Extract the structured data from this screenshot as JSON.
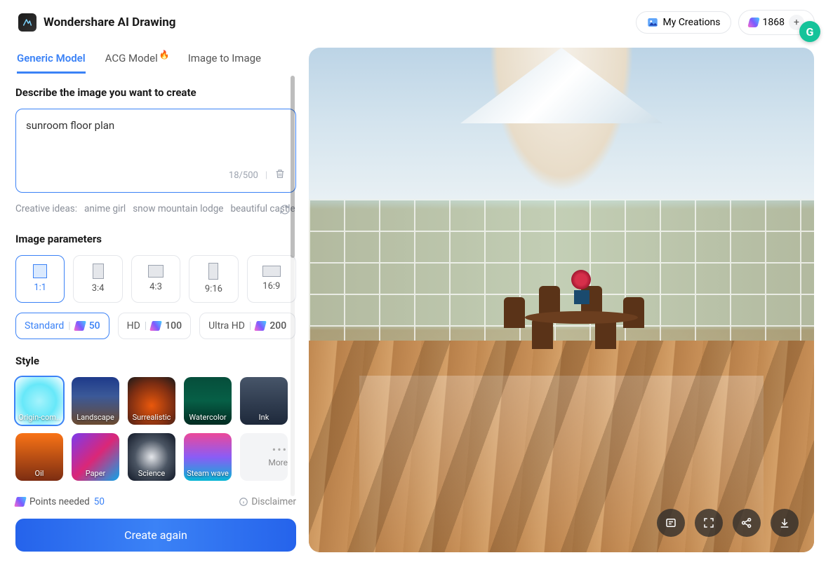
{
  "header": {
    "brand": "Wondershare AI Drawing",
    "my_creations": "My Creations",
    "credits": "1868"
  },
  "tabs": {
    "generic": "Generic Model",
    "acg": "ACG Model",
    "img2img": "Image to Image"
  },
  "prompt": {
    "heading": "Describe the image you want to create",
    "text": "sunroom floor plan",
    "counter": "18/500",
    "ideas_label": "Creative ideas:",
    "idea1": "anime girl",
    "idea2": "snow mountain lodge",
    "idea3": "beautiful castle"
  },
  "params": {
    "heading": "Image parameters",
    "ratios": {
      "r1": "1:1",
      "r2": "3:4",
      "r3": "4:3",
      "r4": "9:16",
      "r5": "16:9"
    },
    "quality": {
      "standard": "Standard",
      "standard_pts": "50",
      "hd": "HD",
      "hd_pts": "100",
      "ultra": "Ultra HD",
      "ultra_pts": "200"
    }
  },
  "style": {
    "heading": "Style",
    "items": {
      "s1": "Origin-com..",
      "s2": "Landscape",
      "s3": "Surrealistic",
      "s4": "Watercolor",
      "s5": "Ink",
      "s6": "Oil",
      "s7": "Paper",
      "s8": "Science",
      "s9": "Steam wave"
    },
    "more": "More"
  },
  "footer": {
    "points_label": "Points needed",
    "points_value": "50",
    "disclaimer": "Disclaimer",
    "create": "Create again"
  }
}
